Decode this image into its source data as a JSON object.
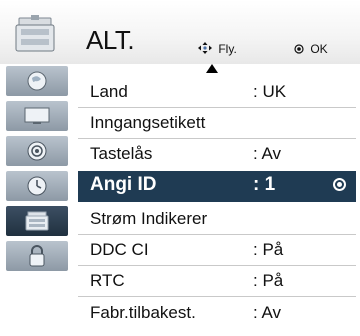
{
  "header": {
    "icon": "setup-suitcase-icon",
    "title": "ALT.",
    "move_hint_label": "Fly.",
    "ok_hint_label": "OK"
  },
  "sidebar": {
    "items": [
      {
        "icon": "globe-icon",
        "active": false
      },
      {
        "icon": "tv-picture-icon",
        "active": false
      },
      {
        "icon": "speaker-audio-icon",
        "active": false
      },
      {
        "icon": "clock-time-icon",
        "active": false
      },
      {
        "icon": "option-suitcase-icon",
        "active": true
      },
      {
        "icon": "lock-icon",
        "active": false
      }
    ]
  },
  "menu": {
    "items": [
      {
        "label": "Land",
        "value": ": UK",
        "selected": false
      },
      {
        "label": "Inngangsetikett",
        "value": "",
        "selected": false
      },
      {
        "label": "Tastelås",
        "value": ": Av",
        "selected": false
      },
      {
        "label": "Angi ID",
        "value": ": 1",
        "selected": true
      },
      {
        "label": "Strøm Indikerer",
        "value": "",
        "selected": false
      },
      {
        "label": "DDC CI",
        "value": ": På",
        "selected": false
      },
      {
        "label": "RTC",
        "value": ": På",
        "selected": false
      },
      {
        "label": "Fabr.tilbakest.",
        "value": ": Av",
        "selected": false
      }
    ]
  },
  "colors": {
    "selected_bg": "#1f3b53",
    "sidebar_active_bg": "#2a3c4f",
    "sidebar_bg": "#a3adb8"
  }
}
